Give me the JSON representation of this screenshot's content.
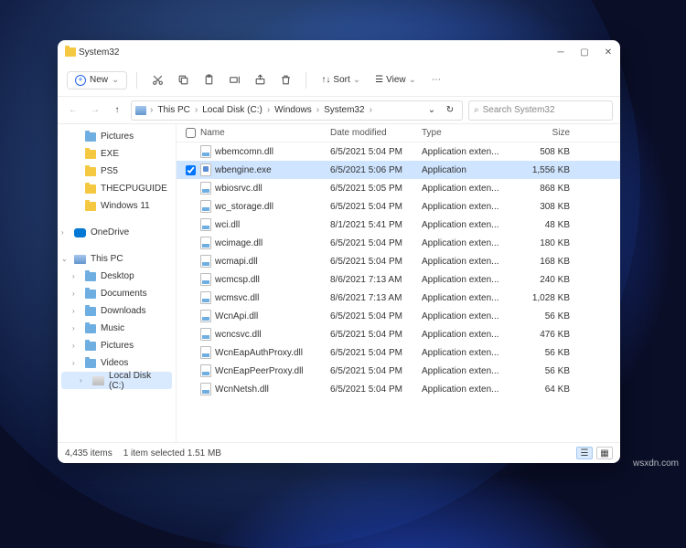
{
  "watermark": "wsxdn.com",
  "window": {
    "title": "System32"
  },
  "toolbar": {
    "new": "New",
    "sort": "Sort",
    "view": "View"
  },
  "breadcrumb": [
    "This PC",
    "Local Disk (C:)",
    "Windows",
    "System32"
  ],
  "search": {
    "placeholder": "Search System32"
  },
  "nav": {
    "quick": [
      "Pictures",
      "EXE",
      "PS5",
      "THECPUGUIDE",
      "Windows 11"
    ],
    "onedrive": "OneDrive",
    "thispc": "This PC",
    "pc": [
      "Desktop",
      "Documents",
      "Downloads",
      "Music",
      "Pictures",
      "Videos",
      "Local Disk (C:)"
    ]
  },
  "columns": [
    "Name",
    "Date modified",
    "Type",
    "Size"
  ],
  "files": [
    {
      "name": "wbemcomn.dll",
      "date": "6/5/2021 5:04 PM",
      "type": "Application exten...",
      "size": "508 KB",
      "icon": "dll"
    },
    {
      "name": "wbengine.exe",
      "date": "6/5/2021 5:06 PM",
      "type": "Application",
      "size": "1,556 KB",
      "icon": "exe",
      "selected": true
    },
    {
      "name": "wbiosrvc.dll",
      "date": "6/5/2021 5:05 PM",
      "type": "Application exten...",
      "size": "868 KB",
      "icon": "dll"
    },
    {
      "name": "wc_storage.dll",
      "date": "6/5/2021 5:04 PM",
      "type": "Application exten...",
      "size": "308 KB",
      "icon": "dll"
    },
    {
      "name": "wci.dll",
      "date": "8/1/2021 5:41 PM",
      "type": "Application exten...",
      "size": "48 KB",
      "icon": "dll"
    },
    {
      "name": "wcimage.dll",
      "date": "6/5/2021 5:04 PM",
      "type": "Application exten...",
      "size": "180 KB",
      "icon": "dll"
    },
    {
      "name": "wcmapi.dll",
      "date": "6/5/2021 5:04 PM",
      "type": "Application exten...",
      "size": "168 KB",
      "icon": "dll"
    },
    {
      "name": "wcmcsp.dll",
      "date": "8/6/2021 7:13 AM",
      "type": "Application exten...",
      "size": "240 KB",
      "icon": "dll"
    },
    {
      "name": "wcmsvc.dll",
      "date": "8/6/2021 7:13 AM",
      "type": "Application exten...",
      "size": "1,028 KB",
      "icon": "dll"
    },
    {
      "name": "WcnApi.dll",
      "date": "6/5/2021 5:04 PM",
      "type": "Application exten...",
      "size": "56 KB",
      "icon": "dll"
    },
    {
      "name": "wcncsvc.dll",
      "date": "6/5/2021 5:04 PM",
      "type": "Application exten...",
      "size": "476 KB",
      "icon": "dll"
    },
    {
      "name": "WcnEapAuthProxy.dll",
      "date": "6/5/2021 5:04 PM",
      "type": "Application exten...",
      "size": "56 KB",
      "icon": "dll"
    },
    {
      "name": "WcnEapPeerProxy.dll",
      "date": "6/5/2021 5:04 PM",
      "type": "Application exten...",
      "size": "56 KB",
      "icon": "dll"
    },
    {
      "name": "WcnNetsh.dll",
      "date": "6/5/2021 5:04 PM",
      "type": "Application exten...",
      "size": "64 KB",
      "icon": "dll"
    }
  ],
  "status": {
    "count": "4,435 items",
    "selection": "1 item selected   1.51 MB"
  }
}
